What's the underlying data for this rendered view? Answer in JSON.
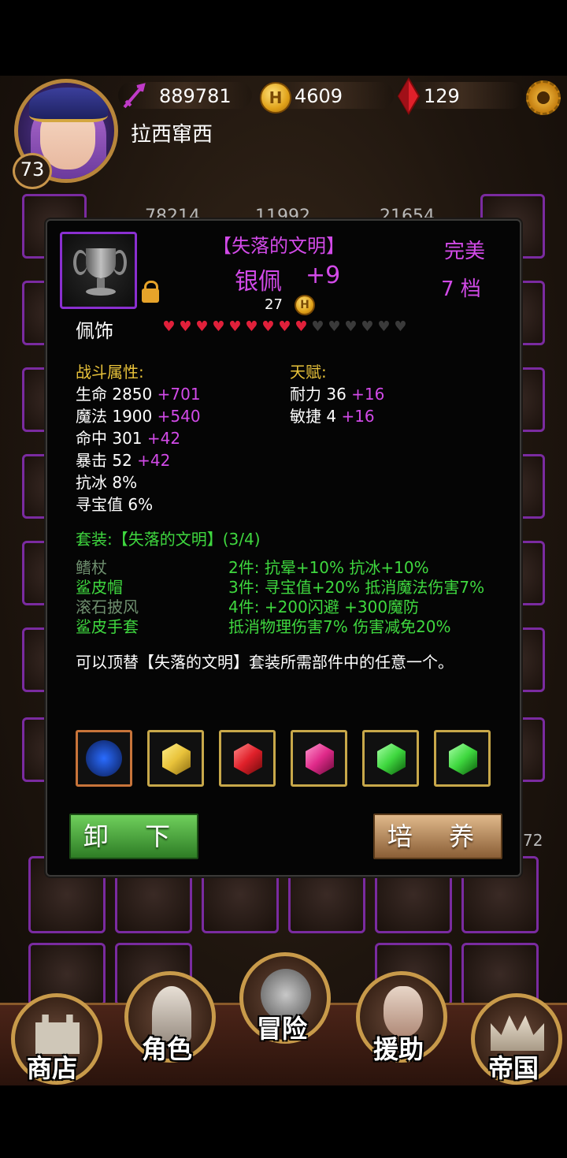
{
  "header": {
    "power": "889781",
    "gold": "4609",
    "gems": "129",
    "player_name": "拉西窜西",
    "level": "73",
    "coin_letter": "H"
  },
  "background": {
    "stats": [
      "78214",
      "11992",
      "21654"
    ],
    "side_number": "72"
  },
  "item": {
    "set_name": "【失落的文明】",
    "name": "银佩",
    "enhance": "+9",
    "quality": "完美",
    "tier": "7 档",
    "price": "27",
    "type": "佩饰",
    "stars_total": 15,
    "stars_filled": 9
  },
  "combat": {
    "title": "战斗属性:",
    "stats": [
      {
        "label": "生命 2850",
        "bonus": "+701"
      },
      {
        "label": "魔法 1900",
        "bonus": "+540"
      },
      {
        "label": "命中 301",
        "bonus": "+42"
      },
      {
        "label": "暴击 52",
        "bonus": "+42"
      },
      {
        "label": "抗冰 8%",
        "bonus": ""
      },
      {
        "label": "寻宝值 6%",
        "bonus": ""
      }
    ]
  },
  "talent": {
    "title": "天赋:",
    "stats": [
      {
        "label": "耐力 36",
        "bonus": "+16"
      },
      {
        "label": "敏捷 4",
        "bonus": "+16"
      }
    ]
  },
  "set": {
    "title": "套装:【失落的文明】(3/4)",
    "pieces": [
      {
        "name": "鳍杖",
        "owned": false
      },
      {
        "name": "鲨皮帽",
        "owned": true
      },
      {
        "name": "滚石披风",
        "owned": false
      },
      {
        "name": "鲨皮手套",
        "owned": true
      }
    ],
    "bonuses": [
      "2件: 抗晕+10% 抗冰+10%",
      "3件: 寻宝值+20% 抵消魔法伤害7%",
      "4件: +200闪避 +300魔防",
      "抵消物理伤害7% 伤害减免20%"
    ]
  },
  "description": "可以顶替【失落的文明】套装所需部件中的任意一个。",
  "gems": [
    {
      "name": "blue-rune-icon",
      "color": "#2a6cff"
    },
    {
      "name": "yellow-gem-icon",
      "color": "#e8c23a"
    },
    {
      "name": "red-gem-icon",
      "color": "#e0202a"
    },
    {
      "name": "pink-gem-icon",
      "color": "#e02a8a"
    },
    {
      "name": "green-gem-icon",
      "color": "#3fd83f"
    },
    {
      "name": "green-gem-icon",
      "color": "#3fd83f"
    }
  ],
  "buttons": {
    "unequip": "卸 下",
    "cultivate": "培 养"
  },
  "nav": {
    "shop": "商店",
    "character": "角色",
    "adventure": "冒险",
    "support": "援助",
    "empire": "帝国"
  }
}
